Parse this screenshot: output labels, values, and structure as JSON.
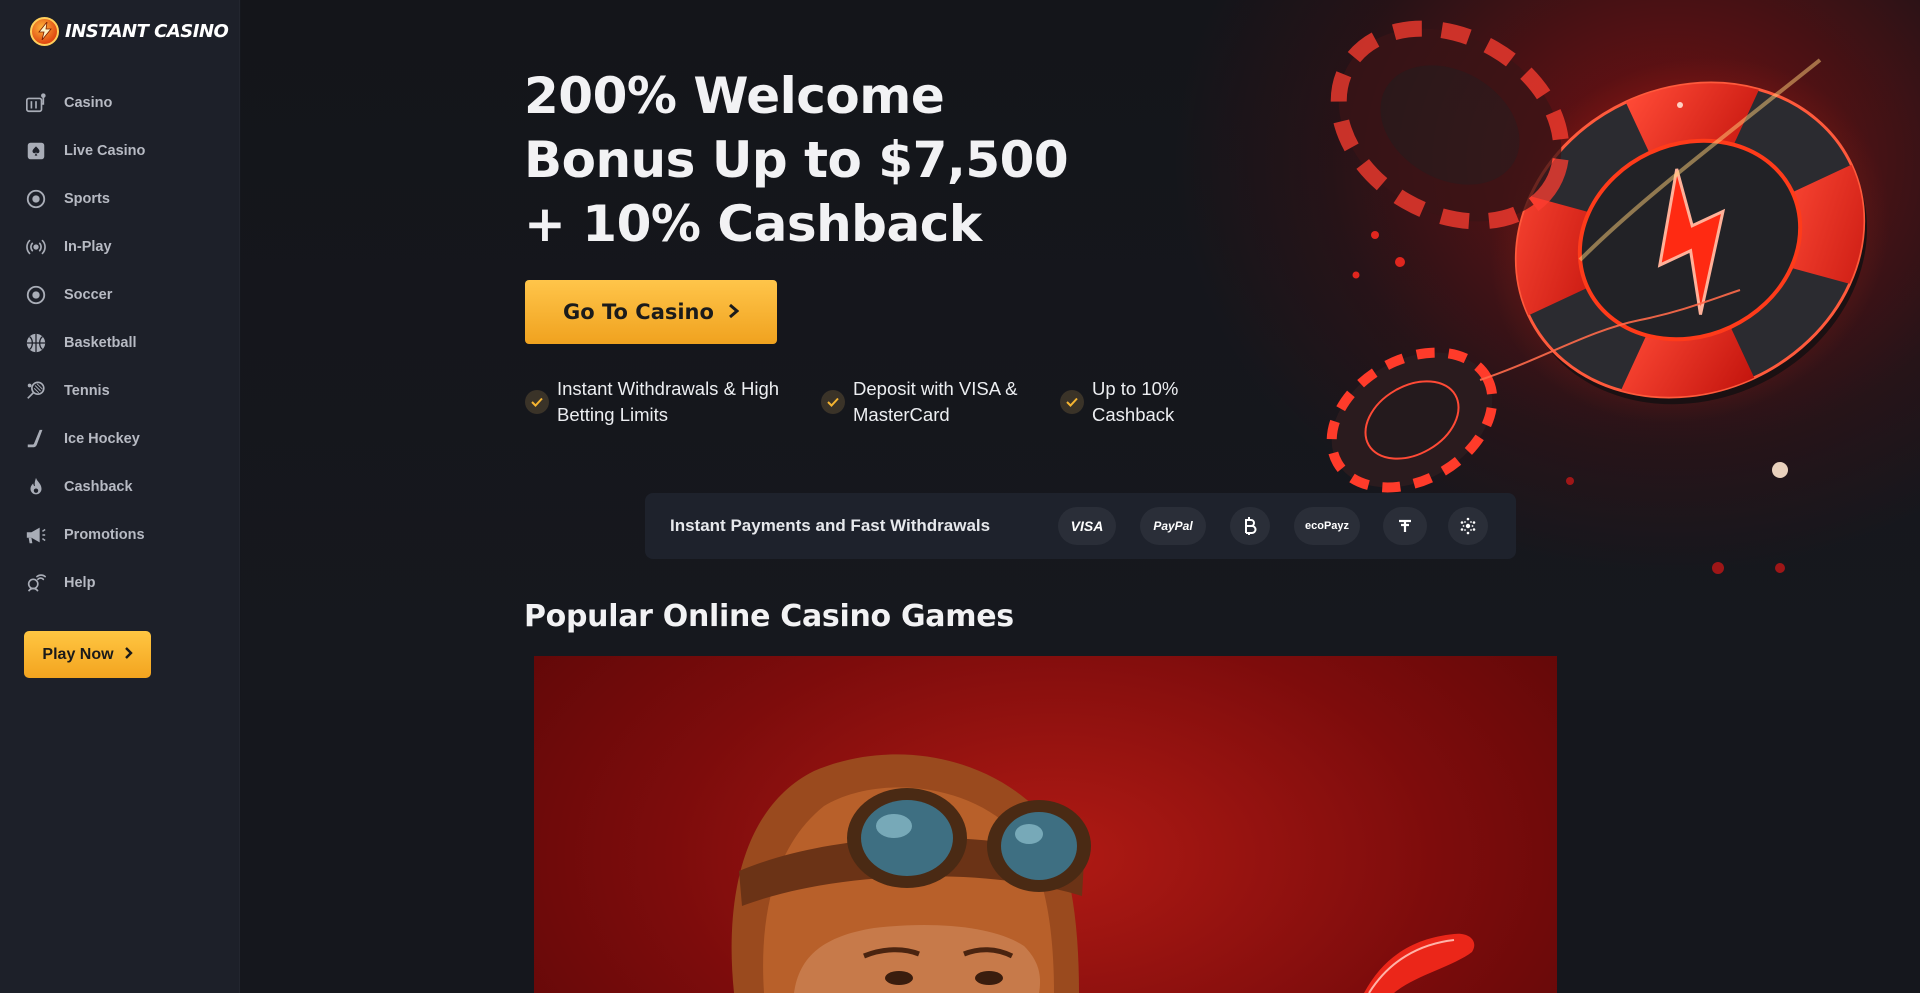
{
  "brand": {
    "name": "INSTANT CASINO"
  },
  "sidebar": {
    "items": [
      {
        "label": "Casino",
        "icon": "slot-machine-icon"
      },
      {
        "label": "Live Casino",
        "icon": "spade-card-icon"
      },
      {
        "label": "Sports",
        "icon": "sports-ball-icon"
      },
      {
        "label": "In-Play",
        "icon": "broadcast-icon"
      },
      {
        "label": "Soccer",
        "icon": "soccer-ball-icon"
      },
      {
        "label": "Basketball",
        "icon": "basketball-icon"
      },
      {
        "label": "Tennis",
        "icon": "tennis-racket-icon"
      },
      {
        "label": "Ice Hockey",
        "icon": "hockey-stick-icon"
      },
      {
        "label": "Cashback",
        "icon": "flame-icon"
      },
      {
        "label": "Promotions",
        "icon": "megaphone-icon"
      },
      {
        "label": "Help",
        "icon": "support-agent-icon"
      }
    ],
    "play_now_label": "Play Now"
  },
  "hero": {
    "title": "200% Welcome Bonus Up to $7,500 + 10% Cashback",
    "cta_label": "Go To Casino",
    "features": [
      "Instant Withdrawals & High Betting Limits",
      "Deposit with VISA & MasterCard",
      "Up to 10% Cashback"
    ]
  },
  "payments": {
    "label": "Instant Payments and Fast Withdrawals",
    "methods": [
      "VISA",
      "PayPal",
      "Bitcoin",
      "ecoPayz",
      "Tether",
      "Cardano"
    ],
    "logo_texts": {
      "visa": "VISA",
      "paypal": "PayPal",
      "ecopayz": "ecoPayz"
    }
  },
  "games": {
    "section_title": "Popular Online Casino Games"
  },
  "colors": {
    "accent": "#f5a623",
    "sidebar_bg": "#1d2029",
    "page_bg": "#15171d",
    "hero_red": "#b01a14"
  }
}
